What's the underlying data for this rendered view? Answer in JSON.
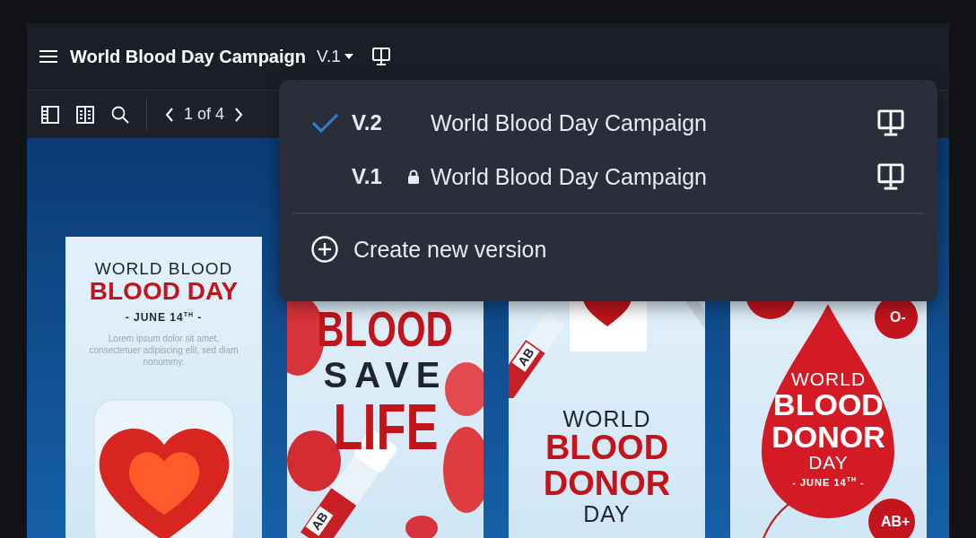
{
  "header": {
    "title": "World Blood Day Campaign",
    "version": "V.1"
  },
  "toolbar": {
    "page_indicator": "1 of 4"
  },
  "version_menu": {
    "items": [
      {
        "version": "V.2",
        "title": "World Blood Day Campaign",
        "selected": true,
        "locked": false
      },
      {
        "version": "V.1",
        "title": "World Blood Day Campaign",
        "selected": false,
        "locked": true
      }
    ],
    "action": "Create new version"
  },
  "posters": [
    {
      "kind": "heart",
      "lines": [
        "WORLD BLOOD",
        "BLOOD DAY",
        "- JUNE 14$^{TH}$ -",
        "Lorem ipsum dolor sit amet, consectetuer adipiscing elit, sed diam nonummy."
      ]
    },
    {
      "kind": "cells",
      "lines": [
        "BLOOD",
        "SAVE",
        "LIFE"
      ],
      "tags": [
        "AB"
      ]
    },
    {
      "kind": "envelope",
      "lines": [
        "WORLD",
        "BLOOD",
        "DONOR",
        "DAY"
      ],
      "tags": [
        "AB"
      ]
    },
    {
      "kind": "drop",
      "lines": [
        "WORLD",
        "BLOOD",
        "DONOR",
        "DAY",
        "- JUNE 14$^{TH}$ -"
      ],
      "tags": [
        "O-",
        "AB+"
      ]
    }
  ]
}
